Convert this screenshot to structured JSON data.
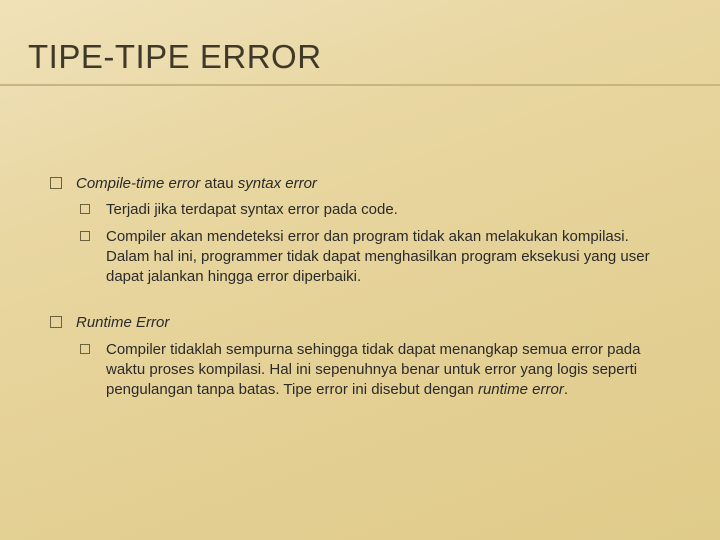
{
  "slide": {
    "title": "TIPE-TIPE ERROR",
    "sections": [
      {
        "heading_italic": "Compile-time error",
        "heading_plain": " atau ",
        "heading_italic2": "syntax error",
        "items": [
          "Terjadi jika terdapat syntax error pada code.",
          "Compiler akan mendeteksi error dan program tidak akan melakukan kompilasi. Dalam hal ini, programmer tidak dapat menghasilkan program eksekusi yang user dapat jalankan hingga error diperbaiki."
        ]
      },
      {
        "heading_italic": "Runtime Error",
        "heading_plain": "",
        "heading_italic2": "",
        "items_rich": [
          {
            "pre": "Compiler tidaklah sempurna sehingga tidak dapat menangkap semua error  pada waktu proses kompilasi. Hal ini sepenuhnya benar untuk error yang logis seperti pengulangan tanpa batas. Tipe error ini disebut dengan ",
            "ital": "runtime error",
            "post": "."
          }
        ]
      }
    ]
  }
}
